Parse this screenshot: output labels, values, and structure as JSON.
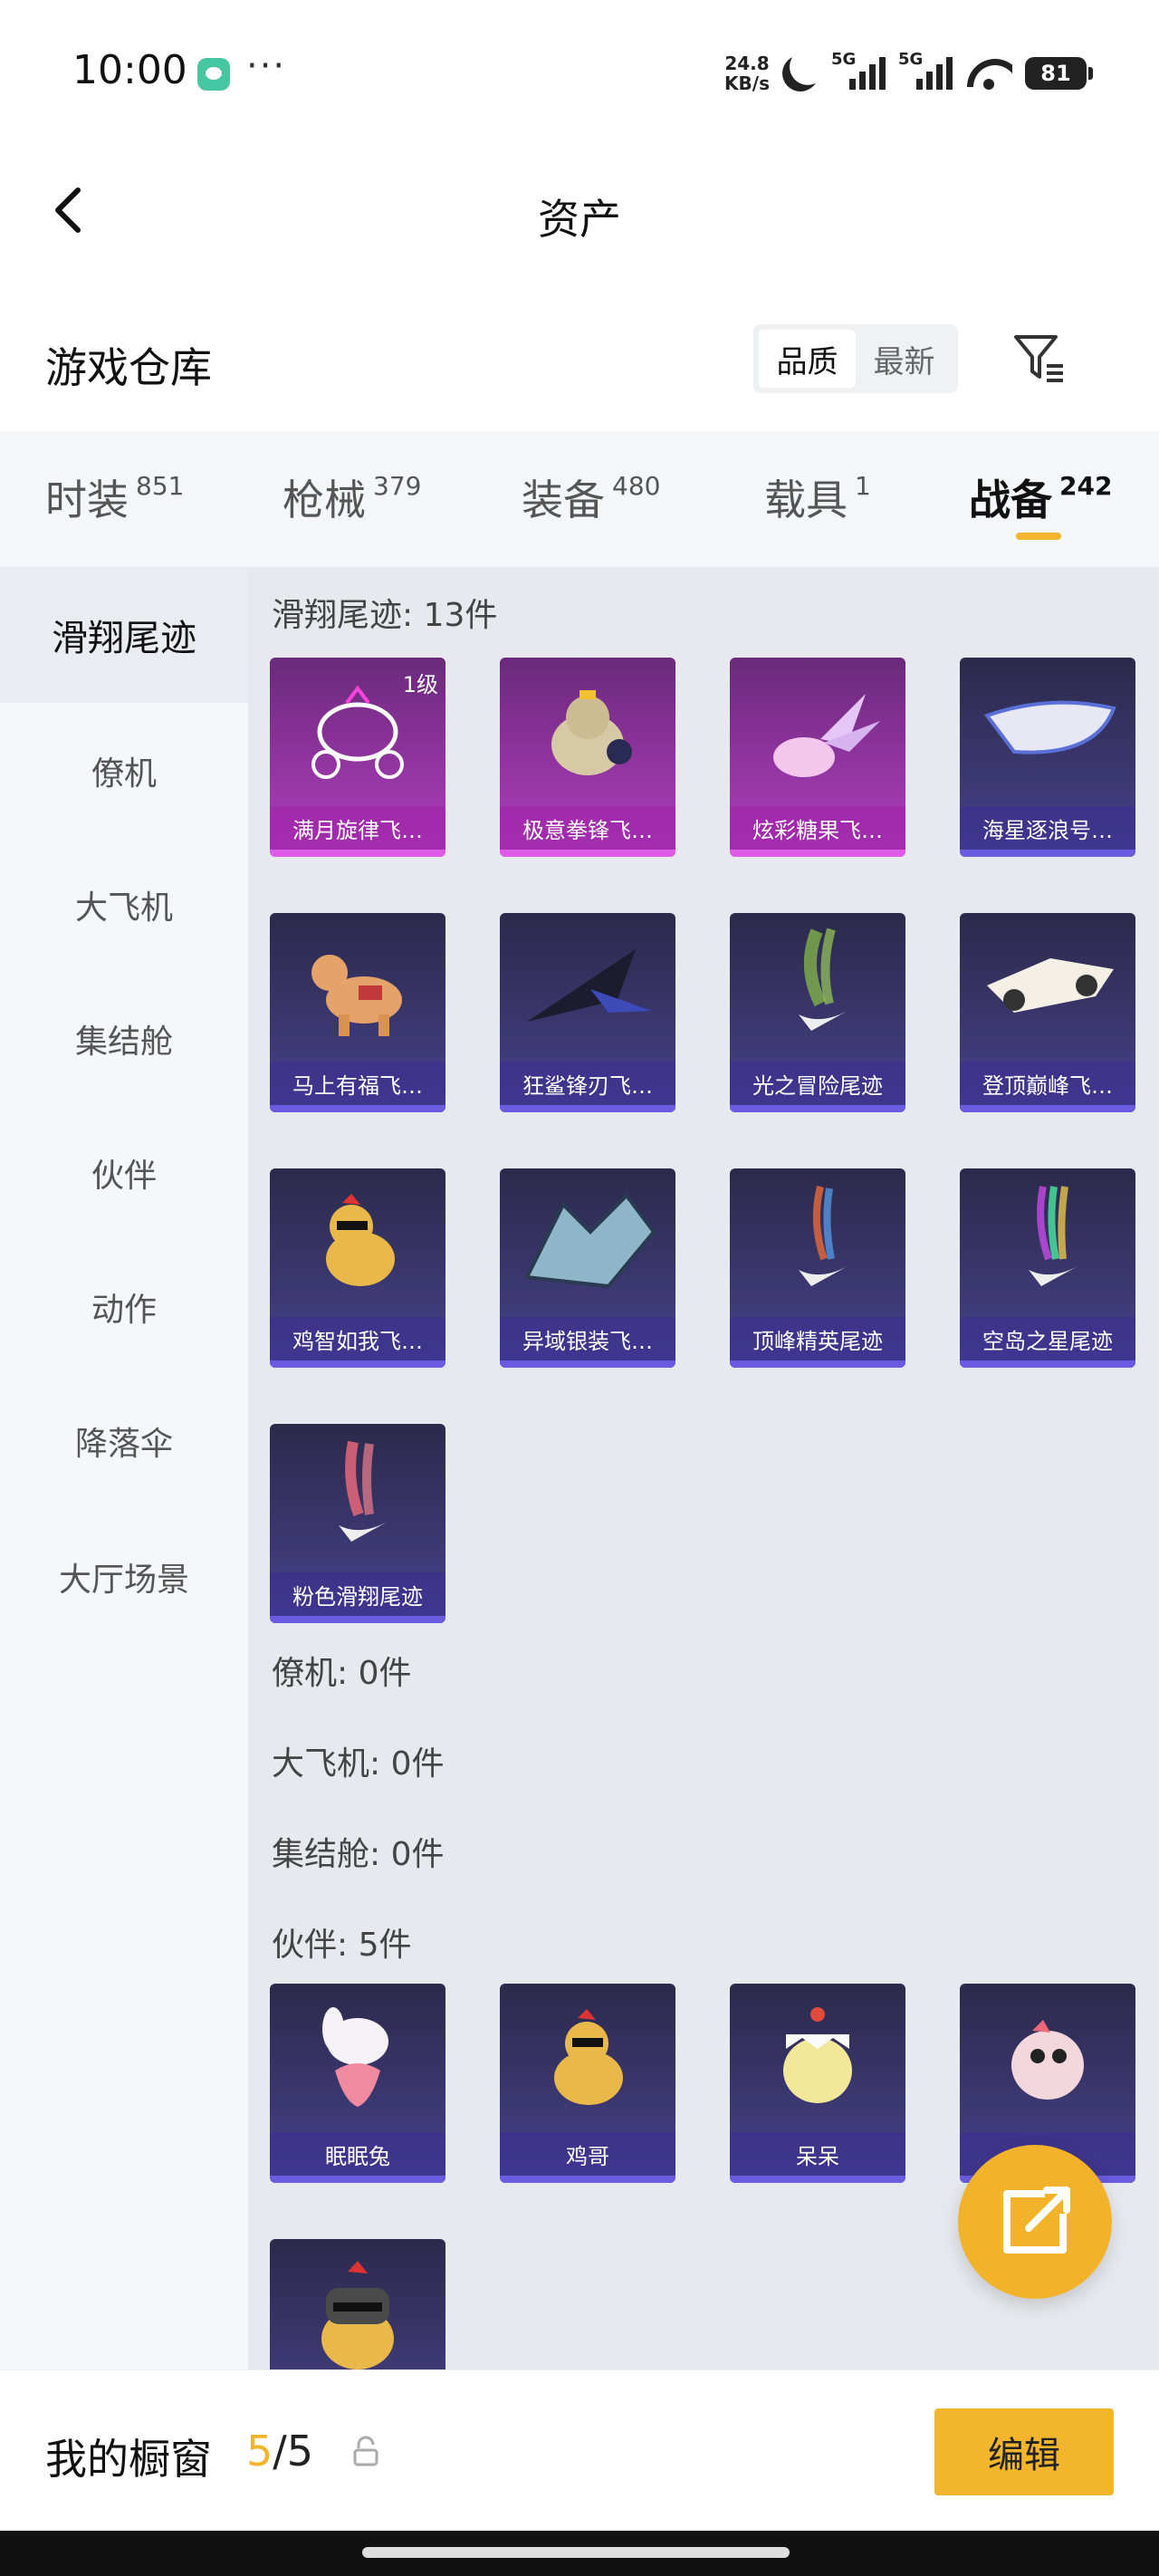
{
  "status_bar": {
    "time": "10:00",
    "net_speed_value": "24.8",
    "net_speed_unit": "KB/s",
    "sim1": "5G",
    "sim2": "5G",
    "battery": "81"
  },
  "nav": {
    "title": "资产"
  },
  "warehouse": {
    "title": "游戏仓库",
    "sort_options": [
      "品质",
      "最新"
    ],
    "sort_selected": "品质"
  },
  "tabs": [
    {
      "label": "时装",
      "count": "851"
    },
    {
      "label": "枪械",
      "count": "379"
    },
    {
      "label": "装备",
      "count": "480"
    },
    {
      "label": "载具",
      "count": "1"
    },
    {
      "label": "战备",
      "count": "242",
      "active": true
    }
  ],
  "sidebar": {
    "items": [
      "滑翔尾迹",
      "僚机",
      "大飞机",
      "集结舱",
      "伙伴",
      "动作",
      "降落伞",
      "大厅场景"
    ],
    "active": "滑翔尾迹"
  },
  "sections": {
    "trail": {
      "title": "滑翔尾迹: 13件",
      "items": [
        {
          "name": "满月旋律飞…",
          "level": "1级"
        },
        {
          "name": "极意拳锋飞…"
        },
        {
          "name": "炫彩糖果飞…"
        },
        {
          "name": "海星逐浪号…"
        },
        {
          "name": "马上有福飞…"
        },
        {
          "name": "狂鲨锋刃飞…"
        },
        {
          "name": "光之冒险尾迹"
        },
        {
          "name": "登顶巅峰飞…"
        },
        {
          "name": "鸡智如我飞…"
        },
        {
          "name": "异域银装飞…"
        },
        {
          "name": "顶峰精英尾迹"
        },
        {
          "name": "空岛之星尾迹"
        },
        {
          "name": "粉色滑翔尾迹"
        }
      ]
    },
    "wingman": {
      "title": "僚机: 0件"
    },
    "plane": {
      "title": "大飞机: 0件"
    },
    "pod": {
      "title": "集结舱: 0件"
    },
    "partner": {
      "title": "伙伴: 5件",
      "items": [
        {
          "name": "眠眠兔"
        },
        {
          "name": "鸡哥"
        },
        {
          "name": "呆呆"
        },
        {
          "name": ""
        },
        {
          "name": ""
        }
      ]
    }
  },
  "bottom": {
    "showcase_label": "我的橱窗",
    "showcase_current": "5",
    "showcase_total": "/5",
    "edit_label": "编辑"
  },
  "colors": {
    "accent": "#f3b52c",
    "card_epic": "#b33ec0",
    "card_rare": "#3f3a78"
  }
}
